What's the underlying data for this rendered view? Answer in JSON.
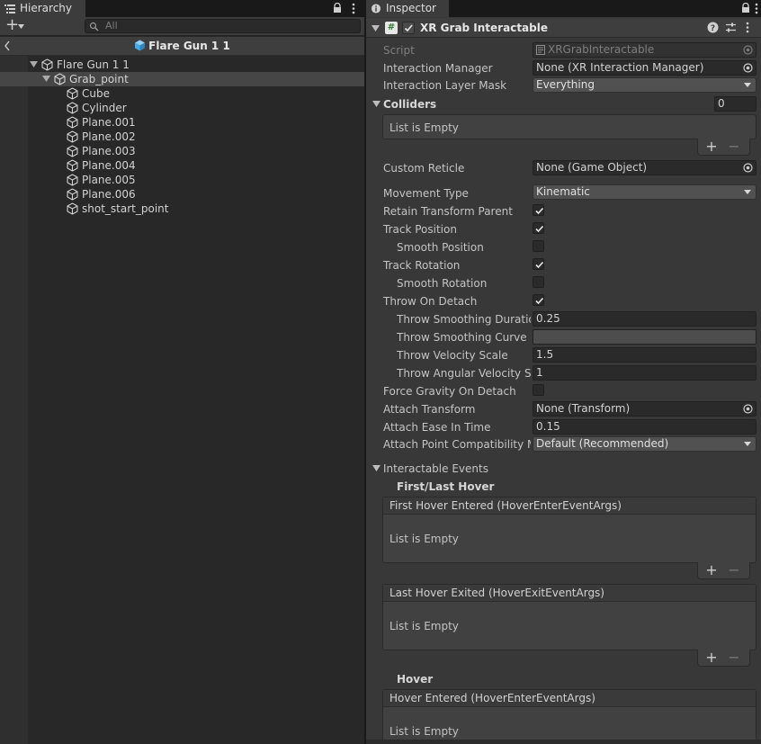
{
  "hierarchy": {
    "tab_label": "Hierarchy",
    "add_button": "+",
    "search_placeholder": "All",
    "scene_title": "Flare Gun 1 1",
    "tree": [
      {
        "label": "Flare Gun 1 1",
        "icon": "cube-outline-icon",
        "expanded": true,
        "selected": false
      },
      {
        "label": "Grab_point",
        "icon": "cube-outline-icon",
        "expanded": true,
        "selected": true
      },
      {
        "label": "Cube",
        "icon": "cube-outline-icon"
      },
      {
        "label": "Cylinder",
        "icon": "cube-outline-icon"
      },
      {
        "label": "Plane.001",
        "icon": "cube-outline-icon"
      },
      {
        "label": "Plane.002",
        "icon": "cube-outline-icon"
      },
      {
        "label": "Plane.003",
        "icon": "cube-outline-icon"
      },
      {
        "label": "Plane.004",
        "icon": "cube-outline-icon"
      },
      {
        "label": "Plane.005",
        "icon": "cube-outline-icon"
      },
      {
        "label": "Plane.006",
        "icon": "cube-outline-icon"
      },
      {
        "label": "shot_start_point",
        "icon": "cube-outline-icon"
      }
    ]
  },
  "inspector": {
    "tab_label": "Inspector",
    "component": {
      "title": "XR Grab Interactable",
      "enabled": true
    },
    "props": {
      "script_label": "Script",
      "script_value": "XRGrabInteractable",
      "interaction_manager_label": "Interaction Manager",
      "interaction_manager_value": "None (XR Interaction Manager)",
      "interaction_layer_mask_label": "Interaction Layer Mask",
      "interaction_layer_mask_value": "Everything",
      "colliders_label": "Colliders",
      "colliders_size": "0",
      "list_empty": "List is Empty",
      "custom_reticle_label": "Custom Reticle",
      "custom_reticle_value": "None (Game Object)",
      "movement_type_label": "Movement Type",
      "movement_type_value": "Kinematic",
      "retain_transform_parent_label": "Retain Transform Parent",
      "track_position_label": "Track Position",
      "smooth_position_label": "Smooth Position",
      "track_rotation_label": "Track Rotation",
      "smooth_rotation_label": "Smooth Rotation",
      "throw_on_detach_label": "Throw On Detach",
      "throw_smoothing_duration_label": "Throw Smoothing Duration",
      "throw_smoothing_duration_value": "0.25",
      "throw_smoothing_curve_label": "Throw Smoothing Curve",
      "throw_velocity_scale_label": "Throw Velocity Scale",
      "throw_velocity_scale_value": "1.5",
      "throw_angular_velocity_scale_label": "Throw Angular Velocity Scale",
      "throw_angular_velocity_scale_value": "1",
      "force_gravity_on_detach_label": "Force Gravity On Detach",
      "attach_transform_label": "Attach Transform",
      "attach_transform_value": "None (Transform)",
      "attach_ease_in_time_label": "Attach Ease In Time",
      "attach_ease_in_time_value": "0.15",
      "attach_point_compat_label": "Attach Point Compatibility Mode",
      "attach_point_compat_value": "Default (Recommended)"
    },
    "toggles": {
      "retain_transform_parent": true,
      "track_position": true,
      "smooth_position": false,
      "track_rotation": true,
      "smooth_rotation": false,
      "throw_on_detach": true,
      "force_gravity_on_detach": false
    },
    "events": {
      "section_label": "Interactable Events",
      "first_last_hover_heading": "First/Last Hover",
      "first_hover_entered": "First Hover Entered (HoverEnterEventArgs)",
      "last_hover_exited": "Last Hover Exited (HoverExitEventArgs)",
      "hover_heading": "Hover",
      "hover_entered": "Hover Entered (HoverEnterEventArgs)"
    },
    "footer": {
      "add": "+",
      "remove": "−"
    }
  }
}
